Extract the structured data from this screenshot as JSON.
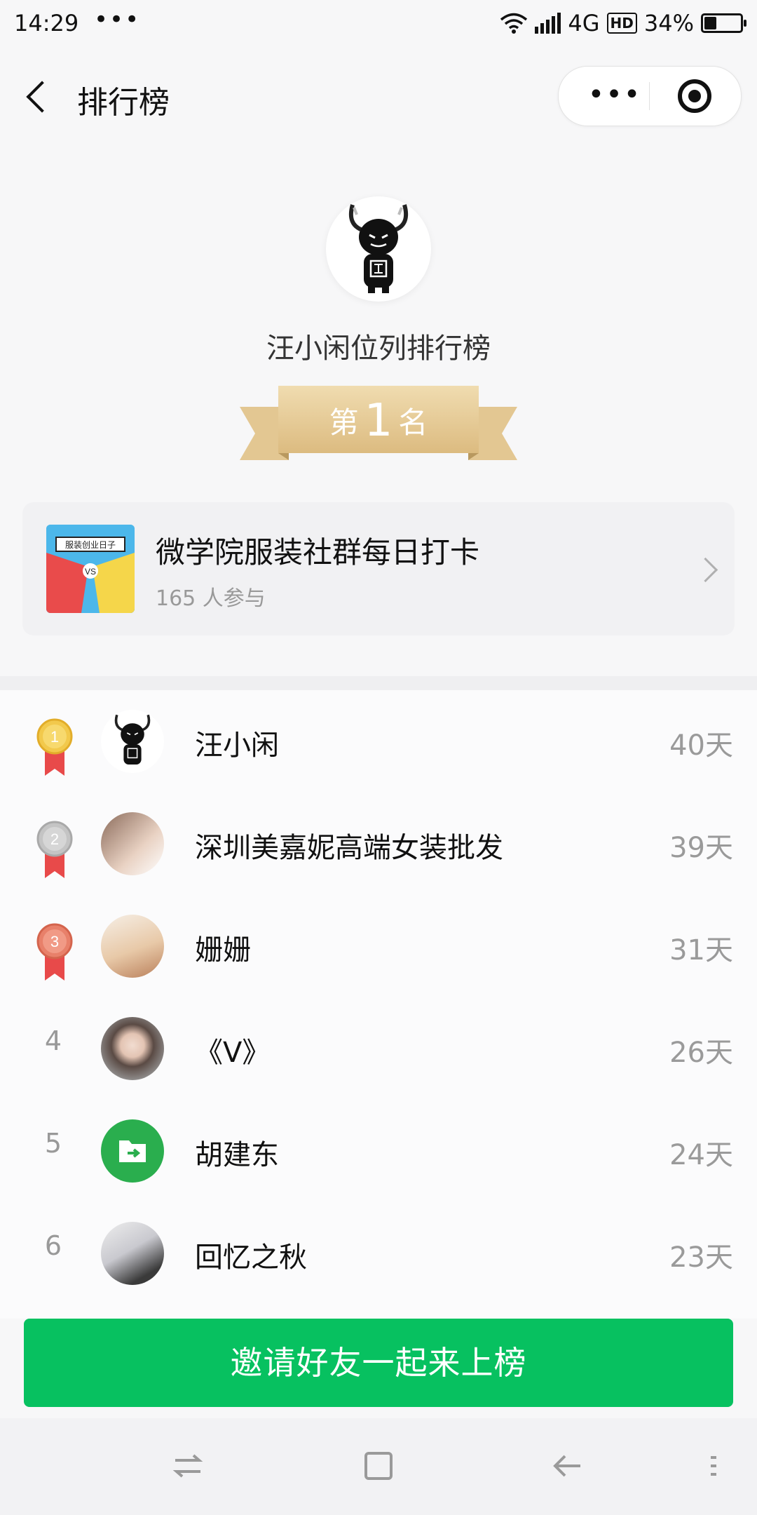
{
  "status_bar": {
    "time": "14:29",
    "more": "•••",
    "network": "4G",
    "hd": "HD",
    "battery_text": "34%",
    "battery_level": 0.34
  },
  "nav": {
    "title": "排行榜",
    "more_label": "•••"
  },
  "header": {
    "subtitle": "汪小闲位列排行榜",
    "rank_prefix": "第",
    "rank_number": "1",
    "rank_suffix": "名"
  },
  "activity": {
    "thumb_text": "服装创业日子",
    "name": "微学院服装社群每日打卡",
    "participants": "165 人参与"
  },
  "ranking": [
    {
      "rank": "1",
      "name": "汪小闲",
      "days": "40天"
    },
    {
      "rank": "2",
      "name": "深圳美嘉妮高端女装批发",
      "days": "39天"
    },
    {
      "rank": "3",
      "name": "姗姗",
      "days": "31天"
    },
    {
      "rank": "4",
      "name": "《V》",
      "days": "26天"
    },
    {
      "rank": "5",
      "name": "胡建东",
      "days": "24天"
    },
    {
      "rank": "6",
      "name": "回忆之秋",
      "days": "23天"
    }
  ],
  "cta": {
    "label": "邀请好友一起来上榜"
  },
  "colors": {
    "accent": "#07c160",
    "gold": "#f2c94c",
    "silver": "#c0c0c0",
    "bronze": "#e8806a",
    "ribbon": "#e8cf9e"
  }
}
